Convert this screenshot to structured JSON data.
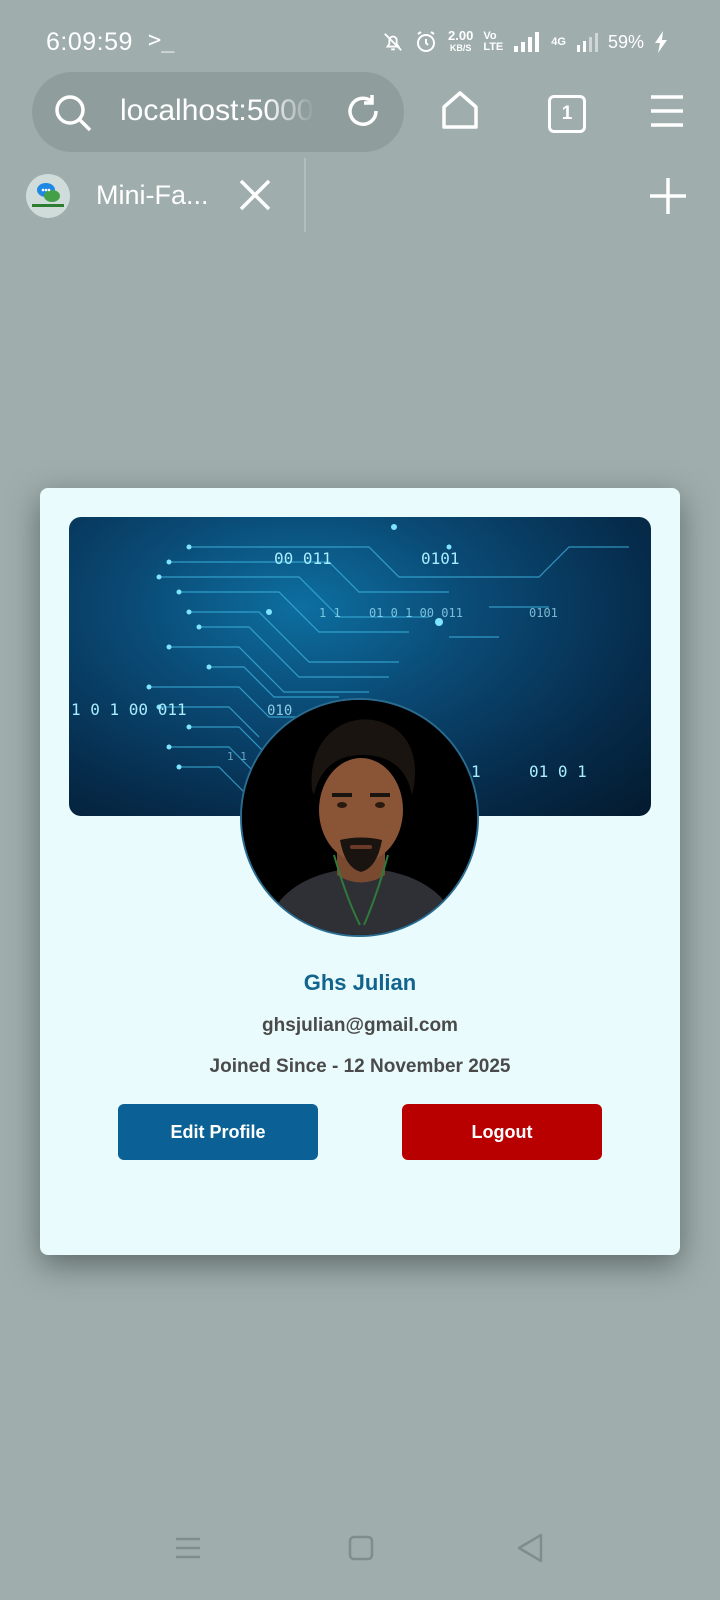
{
  "status_bar": {
    "time": "6:09:59",
    "terminal_glyph": ">_",
    "net_speed_value": "2.00",
    "net_speed_unit": "KB/S",
    "volte_line1": "Vo",
    "volte_line2": "LTE",
    "network_type": "4G",
    "battery_percent": "59%"
  },
  "browser": {
    "url": "localhost:5000",
    "tab_count": "1",
    "tab_title": "Mini-Fa..."
  },
  "cover": {
    "binary_texts": [
      "00  011",
      "0101",
      "1 1",
      "01  0  1  00  011",
      "0101",
      "1  0  1  00  011",
      "010",
      "1",
      "01  0  1",
      "1 1"
    ]
  },
  "profile": {
    "name": "Ghs Julian",
    "email": "ghsjulian@gmail.com",
    "joined": "Joined Since - 12 November 2025"
  },
  "actions": {
    "edit_label": "Edit Profile",
    "logout_label": "Logout"
  },
  "colors": {
    "page_bg": "#9faeac",
    "card_bg": "#e9fbfc",
    "accent": "#12648f",
    "edit_button": "#0b6196",
    "logout_button": "#b80000"
  },
  "icons": {
    "search": "search-icon",
    "reload": "reload-icon",
    "home": "home-icon",
    "menu": "menu-icon",
    "close": "close-icon",
    "add": "plus-icon"
  }
}
